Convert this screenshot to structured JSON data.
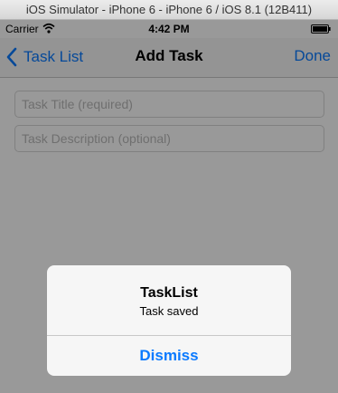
{
  "simulator": {
    "title": "iOS Simulator - iPhone 6 - iPhone 6 / iOS 8.1 (12B411)"
  },
  "status_bar": {
    "carrier": "Carrier",
    "time": "4:42 PM",
    "wifi_icon": "wifi-icon",
    "battery_icon": "battery-icon"
  },
  "nav_bar": {
    "back_label": "Task List",
    "title": "Add Task",
    "done_label": "Done",
    "back_icon": "chevron-left-icon"
  },
  "form": {
    "title_placeholder": "Task Title (required)",
    "description_placeholder": "Task Description (optional)",
    "title_value": "",
    "description_value": ""
  },
  "alert": {
    "title": "TaskList",
    "message": "Task saved",
    "button_label": "Dismiss"
  },
  "colors": {
    "tint": "#0a7aff",
    "nav_background": "#f7f7f7",
    "overlay": "rgba(0,0,0,0.4)"
  }
}
